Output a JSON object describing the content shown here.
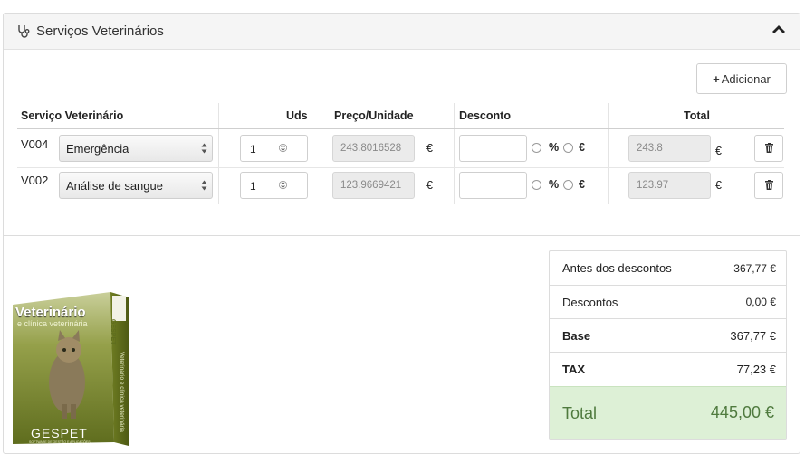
{
  "panel": {
    "title": "Serviços Veterinários",
    "icons": {
      "title": "stethoscope-icon",
      "collapse": "chevron-up-icon"
    }
  },
  "toolbar": {
    "add_label": "Adicionar",
    "add_icon": "plus-icon"
  },
  "table": {
    "headers": {
      "service": "Serviço Veterinário",
      "units": "Uds",
      "unit_price": "Preço/Unidade",
      "discount": "Desconto",
      "total": "Total"
    },
    "rows": [
      {
        "code": "V004",
        "service": "Emergência",
        "qty": "1",
        "unit_price": "243.8016528",
        "currency": "€",
        "discount_value": "",
        "percent_label": "%",
        "euro_label": "€",
        "total": "243.8",
        "total_currency": "€"
      },
      {
        "code": "V002",
        "service": "Análise de sangue",
        "qty": "1",
        "unit_price": "123.9669421",
        "currency": "€",
        "discount_value": "",
        "percent_label": "%",
        "euro_label": "€",
        "total": "123.97",
        "total_currency": "€"
      }
    ]
  },
  "product_box": {
    "title": "Veterinário",
    "subtitle": "e clínica veterinária",
    "brand": "GESPET",
    "side_brand": "GESPET",
    "spine_text": "Veterinário e clínica veterinária",
    "tagline": "SOFTWARE DE GESTÃO E APLICAÇÕES"
  },
  "summary": {
    "before_discount_label": "Antes dos descontos",
    "before_discount_value": "367,77 €",
    "discounts_label": "Descontos",
    "discounts_value": "0,00 €",
    "base_label": "Base",
    "base_value": "367,77 €",
    "tax_label": "TAX",
    "tax_value": "77,23 €",
    "total_label": "Total",
    "total_value": "445,00 €"
  },
  "colors": {
    "total_bg": "#ddf0d6",
    "total_text": "#4f7a3e",
    "box_green": "#7a8a28"
  }
}
